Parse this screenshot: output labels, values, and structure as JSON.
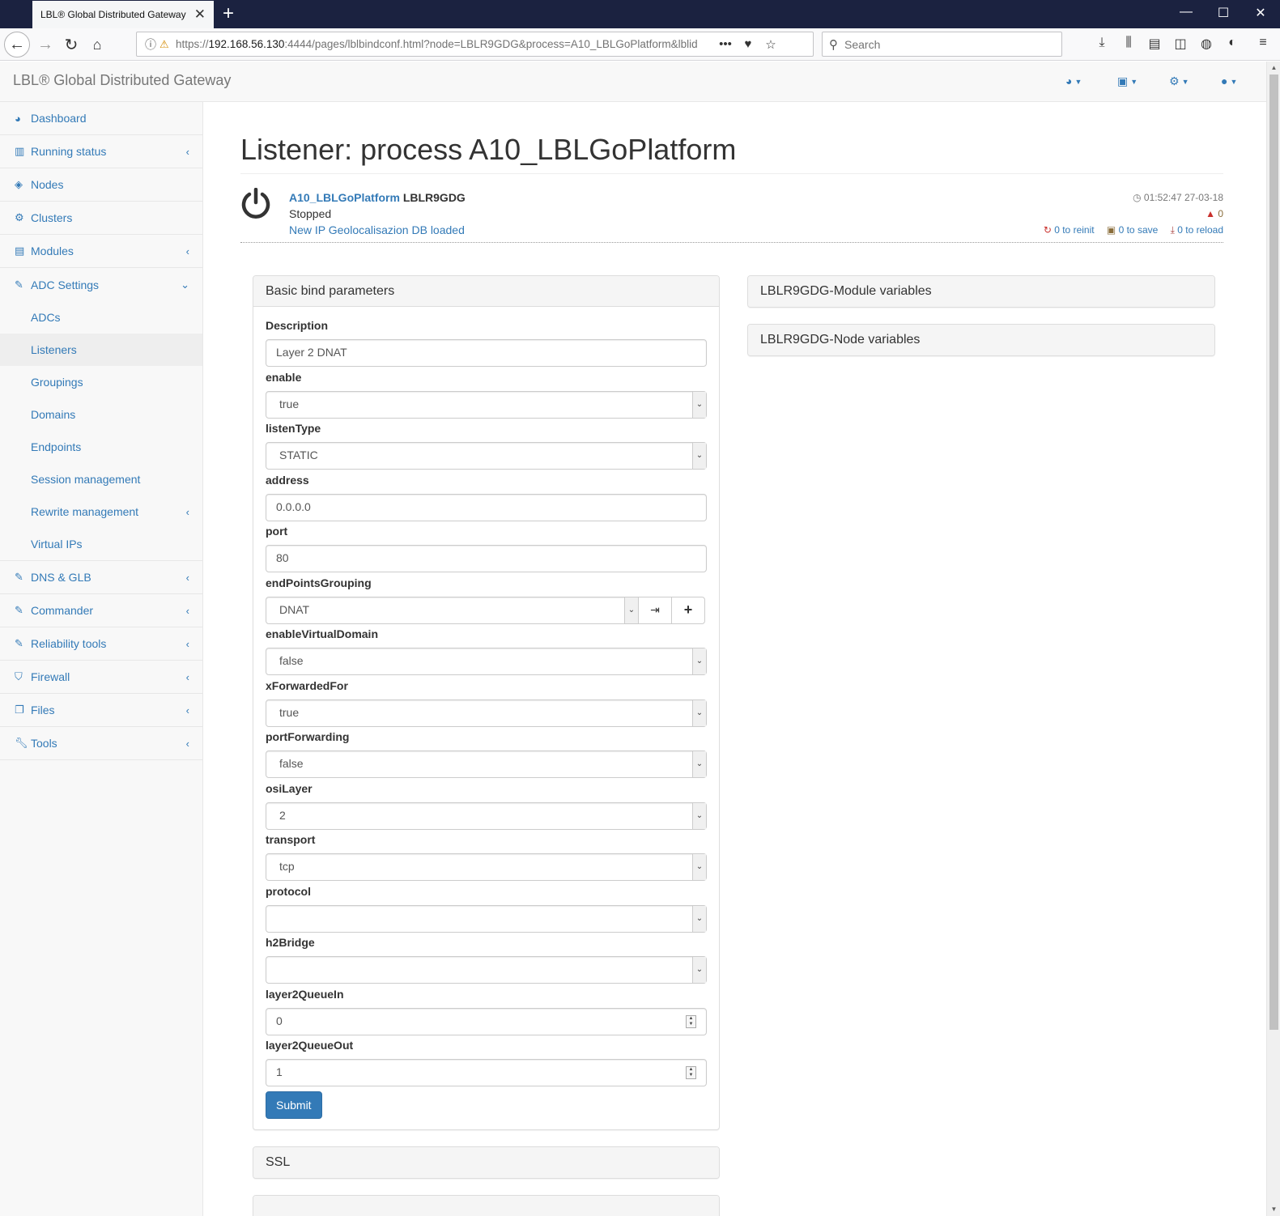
{
  "browser": {
    "tab_title": "LBL® Global Distributed Gateway",
    "url_prefix": "https://",
    "url_host": "192.168.56.130",
    "url_rest": ":4444/pages/lblbindconf.html?node=LBLR9GDG&process=A10_LBLGoPlatform&lblid",
    "search_placeholder": "Search"
  },
  "app": {
    "brand": "LBL® Global Distributed Gateway"
  },
  "sidebar": {
    "items": [
      {
        "label": "Dashboard",
        "icon": "dashboard-icon"
      },
      {
        "label": "Running status",
        "icon": "bar-chart-icon"
      },
      {
        "label": "Nodes",
        "icon": "cube-icon"
      },
      {
        "label": "Clusters",
        "icon": "cogs-icon"
      },
      {
        "label": "Modules",
        "icon": "list-icon"
      },
      {
        "label": "ADC Settings",
        "icon": "edit-icon"
      }
    ],
    "adc_sub": [
      {
        "label": "ADCs"
      },
      {
        "label": "Listeners"
      },
      {
        "label": "Groupings"
      },
      {
        "label": "Domains"
      },
      {
        "label": "Endpoints"
      },
      {
        "label": "Session management"
      },
      {
        "label": "Rewrite management"
      },
      {
        "label": "Virtual IPs"
      }
    ],
    "items2": [
      {
        "label": "DNS & GLB",
        "icon": "edit-icon"
      },
      {
        "label": "Commander",
        "icon": "edit-icon"
      },
      {
        "label": "Reliability tools",
        "icon": "edit-icon"
      },
      {
        "label": "Firewall",
        "icon": "shield-icon"
      },
      {
        "label": "Files",
        "icon": "files-icon"
      },
      {
        "label": "Tools",
        "icon": "wrench-icon"
      }
    ]
  },
  "page": {
    "title": "Listener: process A10_LBLGoPlatform"
  },
  "status": {
    "process": "A10_LBLGoPlatform",
    "node": "LBLR9GDG",
    "state": "Stopped",
    "message": "New IP Geolocalisazion DB loaded",
    "time": "01:52:47 27-03-18",
    "warnings": "0",
    "reinit": "0 to reinit",
    "save": "0 to save",
    "reload": "0 to reload"
  },
  "basic": {
    "heading": "Basic bind parameters",
    "fields": {
      "description": {
        "label": "Description",
        "value": "Layer 2 DNAT"
      },
      "enable": {
        "label": "enable",
        "value": "true"
      },
      "listenType": {
        "label": "listenType",
        "value": "STATIC"
      },
      "address": {
        "label": "address",
        "value": "0.0.0.0"
      },
      "port": {
        "label": "port",
        "value": "80"
      },
      "endPointsGrouping": {
        "label": "endPointsGrouping",
        "value": "DNAT"
      },
      "enableVirtualDomain": {
        "label": "enableVirtualDomain",
        "value": "false"
      },
      "xForwardedFor": {
        "label": "xForwardedFor",
        "value": "true"
      },
      "portForwarding": {
        "label": "portForwarding",
        "value": "false"
      },
      "osiLayer": {
        "label": "osiLayer",
        "value": "2"
      },
      "transport": {
        "label": "transport",
        "value": "tcp"
      },
      "protocol": {
        "label": "protocol",
        "value": ""
      },
      "h2Bridge": {
        "label": "h2Bridge",
        "value": ""
      },
      "layer2QueueIn": {
        "label": "layer2QueueIn",
        "value": "0"
      },
      "layer2QueueOut": {
        "label": "layer2QueueOut",
        "value": "1"
      }
    },
    "submit": "Submit"
  },
  "panels": {
    "ssl": "SSL",
    "module_vars": "LBLR9GDG-Module variables",
    "node_vars": "LBLR9GDG-Node variables"
  },
  "colors": {
    "link": "#337ab7",
    "primary": "#337ab7",
    "titlebar": "#1b2240"
  }
}
